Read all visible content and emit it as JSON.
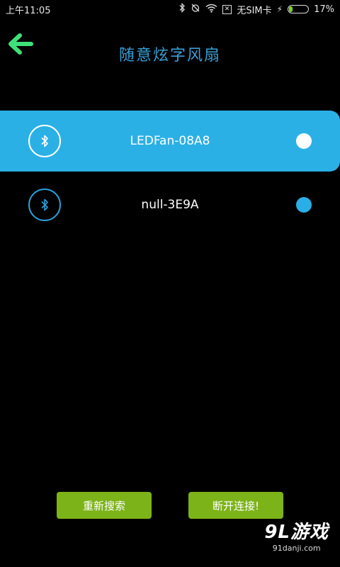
{
  "status_bar": {
    "time": "上午11:05",
    "sim_text": "无SIM卡",
    "sim_box": "✕",
    "battery_percent": "17%",
    "battery_level": 0.17
  },
  "header": {
    "title": "随意炫字风扇"
  },
  "devices": [
    {
      "name": "LEDFan-08A8",
      "selected": true
    },
    {
      "name": "null-3E9A",
      "selected": false
    }
  ],
  "buttons": {
    "rescan_label": "重新搜索",
    "disconnect_label": "断开连接!"
  },
  "watermark": {
    "main": "9L游戏",
    "sub": "91danji.com"
  },
  "colors": {
    "accent_blue": "#2bb0e6",
    "title_blue": "#3a9fd6",
    "button_green": "#7cb319",
    "back_arrow": "#3fe07a"
  }
}
